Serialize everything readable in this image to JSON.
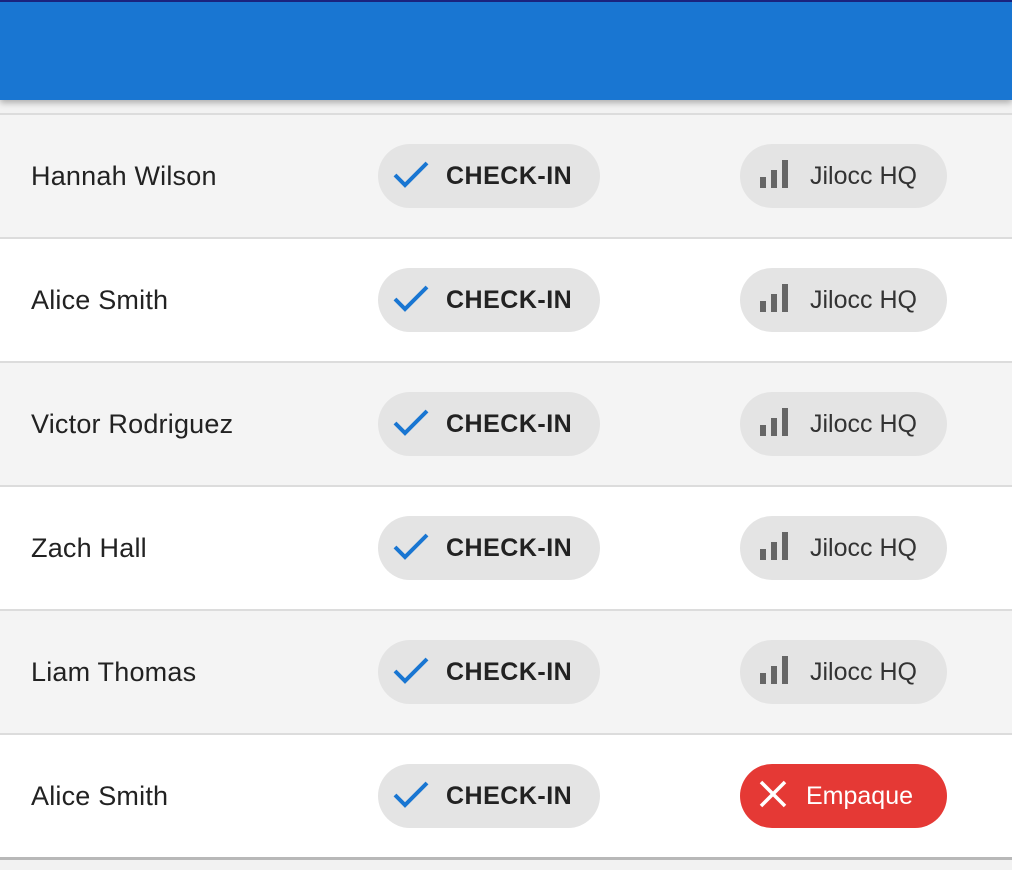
{
  "appbar": {
    "color": "#1976d2"
  },
  "rows": [
    {
      "name": "Hannah Wilson",
      "action": {
        "icon": "check-icon",
        "label": "CHECK-IN"
      },
      "location": {
        "icon": "signal-bars-icon",
        "label": "Jilocc HQ",
        "status": "normal"
      }
    },
    {
      "name": "Alice Smith",
      "action": {
        "icon": "check-icon",
        "label": "CHECK-IN"
      },
      "location": {
        "icon": "signal-bars-icon",
        "label": "Jilocc HQ",
        "status": "normal"
      }
    },
    {
      "name": "Victor Rodriguez",
      "action": {
        "icon": "check-icon",
        "label": "CHECK-IN"
      },
      "location": {
        "icon": "signal-bars-icon",
        "label": "Jilocc HQ",
        "status": "normal"
      }
    },
    {
      "name": "Zach Hall",
      "action": {
        "icon": "check-icon",
        "label": "CHECK-IN"
      },
      "location": {
        "icon": "signal-bars-icon",
        "label": "Jilocc HQ",
        "status": "normal"
      }
    },
    {
      "name": "Liam Thomas",
      "action": {
        "icon": "check-icon",
        "label": "CHECK-IN"
      },
      "location": {
        "icon": "signal-bars-icon",
        "label": "Jilocc HQ",
        "status": "normal"
      }
    },
    {
      "name": "Alice Smith",
      "action": {
        "icon": "check-icon",
        "label": "CHECK-IN"
      },
      "location": {
        "icon": "close-icon",
        "label": "Empaque",
        "status": "error"
      }
    }
  ],
  "colors": {
    "accent": "#1976d2",
    "check": "#1976d2",
    "error": "#e53935",
    "chip": "#e4e4e4"
  }
}
